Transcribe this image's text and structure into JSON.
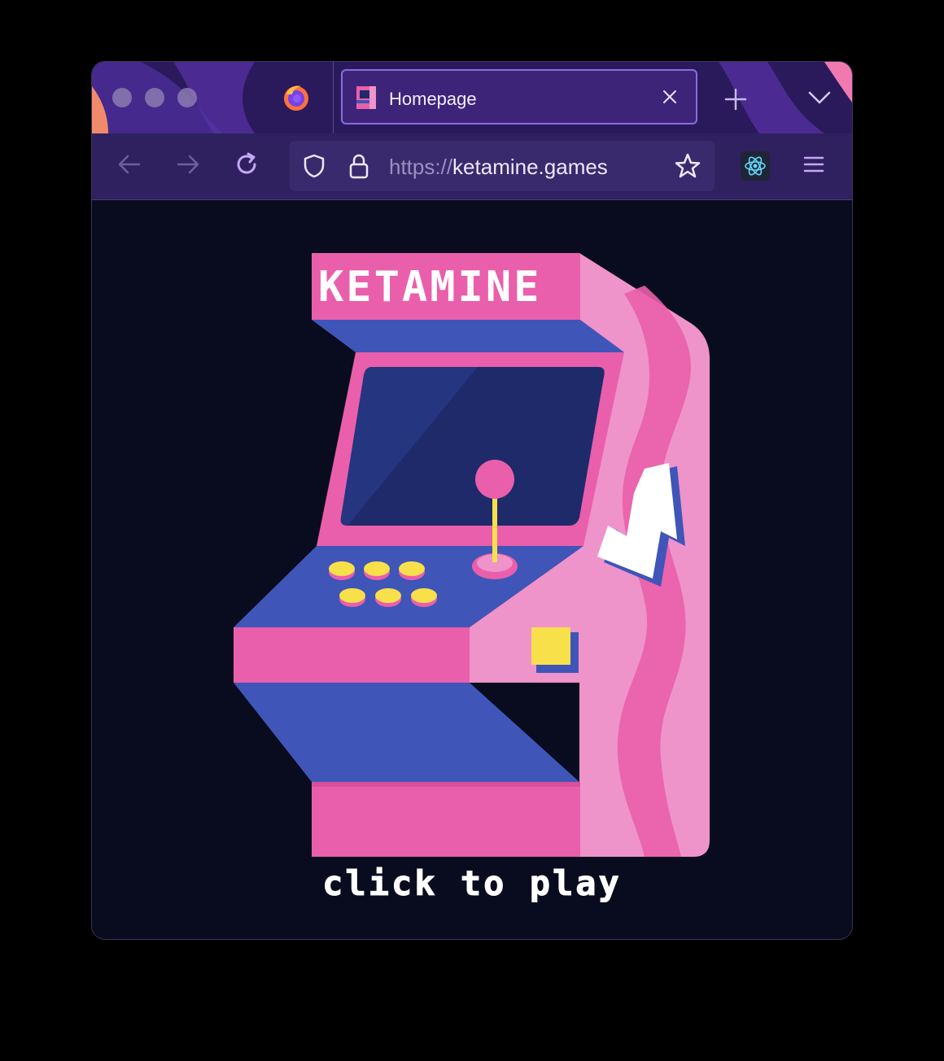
{
  "tab": {
    "title": "Homepage",
    "close": "×"
  },
  "url": {
    "scheme": "https://",
    "host": "ketamine.games"
  },
  "page": {
    "marquee": "KETAMINE",
    "cta": "click to play"
  },
  "colors": {
    "window_bg": "#090b1e",
    "tabbar_bg": "#2a1a5c",
    "accent": "#8b6be0",
    "cabinet_pink": "#e95fab",
    "cabinet_light_pink": "#ef93cb",
    "cabinet_blue": "#3f55b8",
    "screen": "#1e2a6a",
    "button_yellow": "#f8e04a"
  },
  "icons": {
    "browser": "firefox-icon",
    "back": "arrow-left-icon",
    "forward": "arrow-right-icon",
    "reload": "reload-icon",
    "tracking": "shield-icon",
    "secure": "lock-icon",
    "bookmark": "star-icon",
    "extension": "react-icon",
    "menu": "hamburger-icon"
  }
}
